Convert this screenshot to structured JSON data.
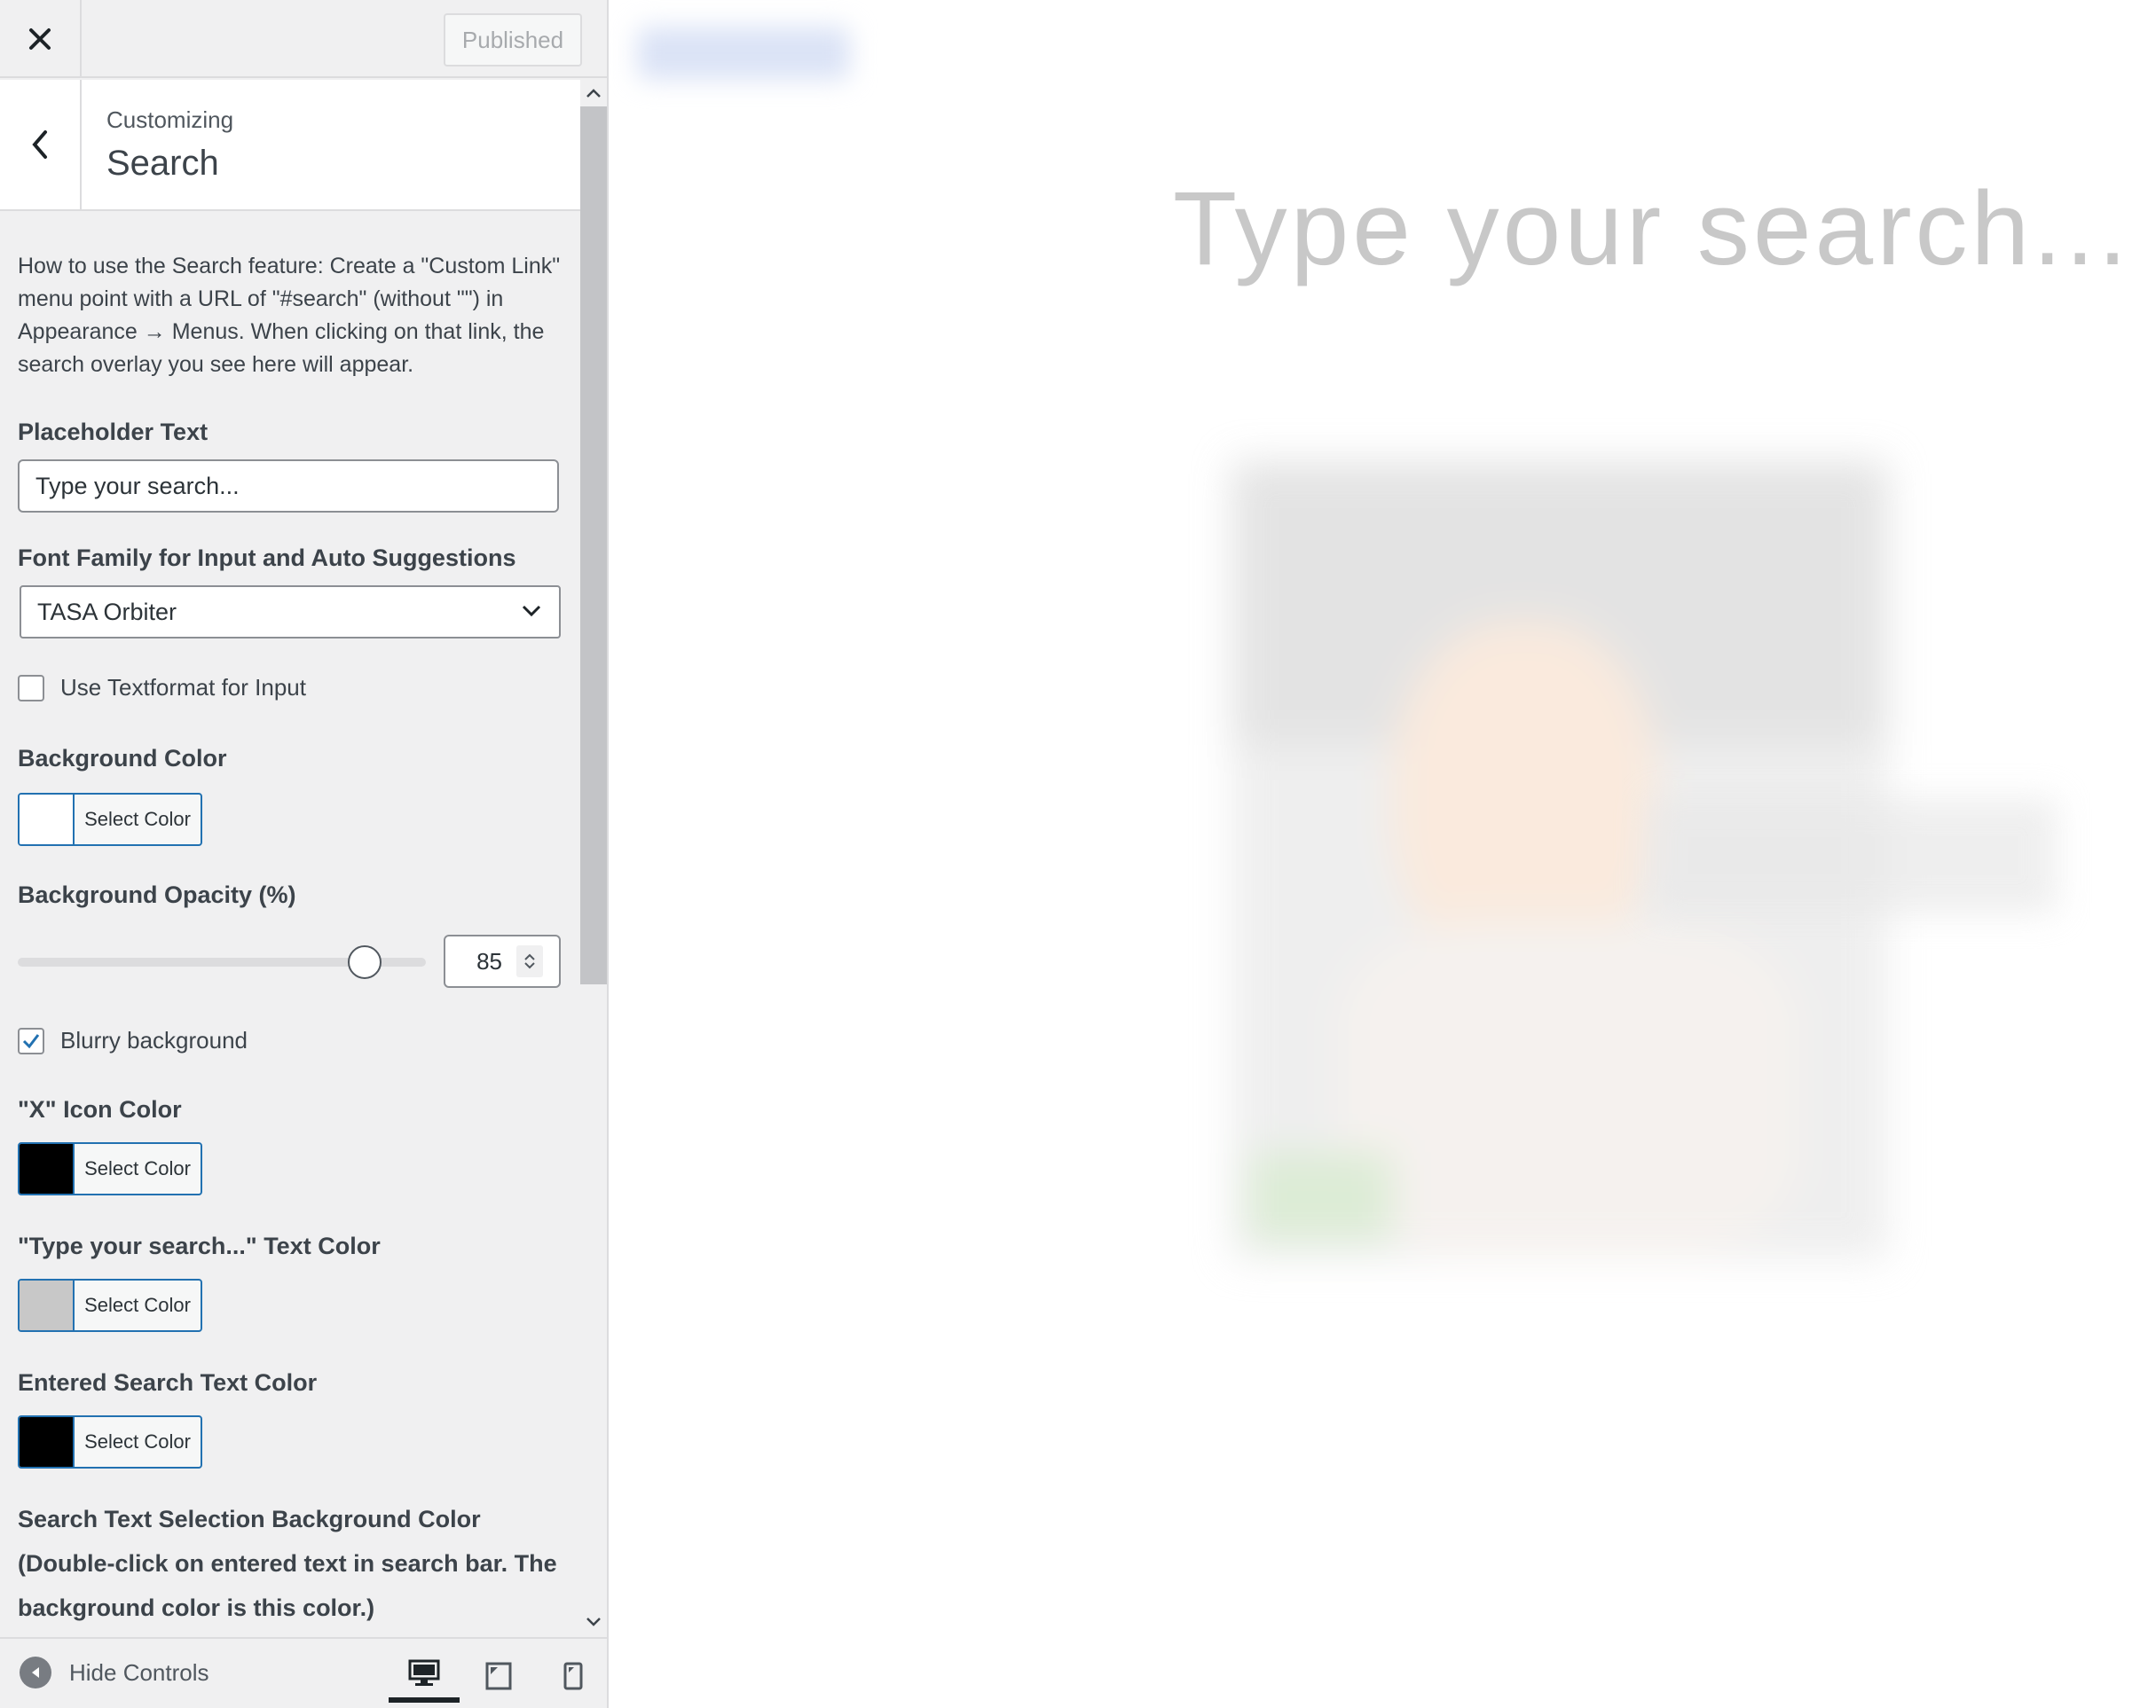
{
  "topbar": {
    "close_icon": "close-icon",
    "published_label": "Published"
  },
  "section": {
    "subtitle": "Customizing",
    "title": "Search",
    "back_icon": "chevron-left-icon"
  },
  "description": "How to use the Search feature: Create a \"Custom Link\" menu point with a URL of \"#search\" (without \"\") in Appearance → Menus. When clicking on that link, the search overlay you see here will appear.",
  "controls": {
    "placeholder": {
      "label": "Placeholder Text",
      "value": "Type your search..."
    },
    "font_family": {
      "label": "Font Family for Input and Auto Suggestions",
      "selected": "TASA Orbiter"
    },
    "textformat": {
      "label": "Use Textformat for Input",
      "checked": false
    },
    "background_color": {
      "label": "Background Color",
      "button": "Select Color",
      "color": "#ffffff"
    },
    "background_opacity": {
      "label": "Background Opacity (%)",
      "value": "85",
      "slider_value": 85,
      "min": 0,
      "max": 100
    },
    "blurry": {
      "label": "Blurry background",
      "checked": true
    },
    "x_icon_color": {
      "label": "\"X\" Icon Color",
      "button": "Select Color",
      "color": "#000000"
    },
    "placeholder_color": {
      "label": "\"Type your search...\" Text Color",
      "button": "Select Color",
      "color": "#c8c8c8"
    },
    "entered_text_color": {
      "label": "Entered Search Text Color",
      "button": "Select Color",
      "color": "#000000"
    },
    "selection_bg_color": {
      "label_line1": "Search Text Selection Background Color",
      "label_line2": "(Double-click on entered text in search bar. The",
      "label_line3": "background color is this color.)"
    }
  },
  "footer": {
    "hide_label": "Hide Controls",
    "devices": [
      "desktop-icon",
      "tablet-icon",
      "mobile-icon"
    ],
    "active_device": "desktop"
  },
  "preview": {
    "search_placeholder": "Type your search..."
  },
  "colors": {
    "accent": "#2271b1",
    "sidebar_bg": "#f0f0f1",
    "border": "#dcdcde"
  }
}
